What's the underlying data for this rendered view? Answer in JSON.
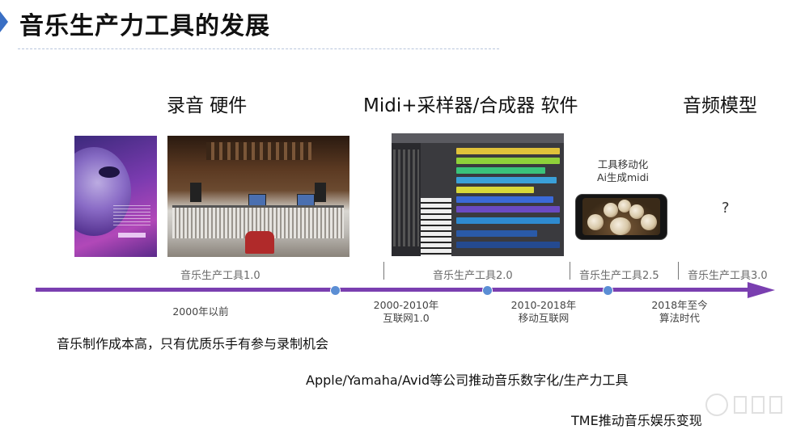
{
  "title": "音乐生产力工具的发展",
  "sections": {
    "record": "录音 硬件",
    "midi": "Midi+采样器/合成器 软件",
    "model": "音频模型"
  },
  "captions": {
    "mobile_line1": "工具移动化",
    "mobile_line2": "Ai生成midi",
    "question": "?"
  },
  "versions": {
    "v1": "音乐生产工具1.0",
    "v2": "音乐生产工具2.0",
    "v25": "音乐生产工具2.5",
    "v3": "音乐生产工具3.0"
  },
  "eras": {
    "e1": "2000年以前",
    "e2_line1": "2000-2010年",
    "e2_line2": "互联网1.0",
    "e3_line1": "2010-2018年",
    "e3_line2": "移动互联网",
    "e4_line1": "2018年至今",
    "e4_line2": "算法时代"
  },
  "descriptions": {
    "d1": "音乐制作成本高，只有优质乐手有参与录制机会",
    "d2": "Apple/Yamaha/Avid等公司推动音乐数字化/生产力工具",
    "d3": "TME推动音乐娱乐变现"
  },
  "colors": {
    "timeline": "#7a3fb0",
    "timeline_dot": "#5b8ed4",
    "accent": "#3a6fc4"
  }
}
